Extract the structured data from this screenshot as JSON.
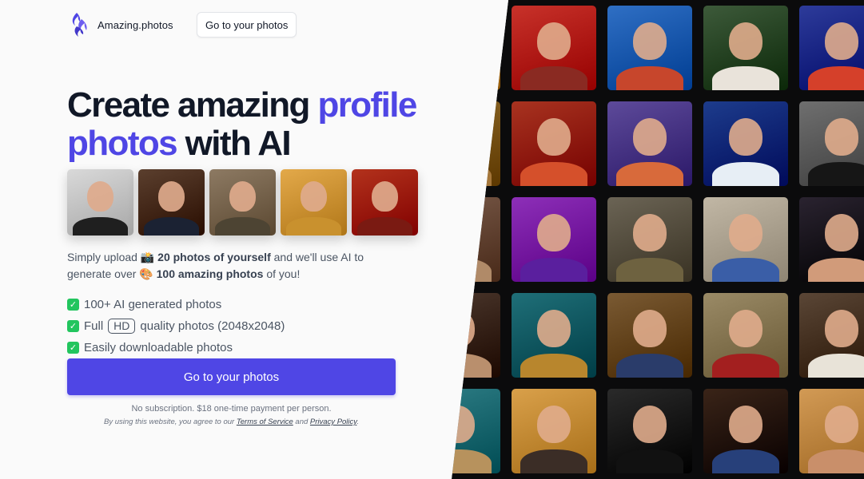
{
  "header": {
    "logo_text": "Amazing.photos",
    "nav_button": "Go to your photos"
  },
  "hero": {
    "title_part1": "Create amazing ",
    "title_accent1": "profile",
    "title_accent2": "photos",
    "title_part2": " with AI"
  },
  "description": {
    "t1": "Simply upload ",
    "emoji1": "📸",
    "b1": " 20 photos of yourself",
    "t2": " and we'll use AI to generate over ",
    "emoji2": "🎨",
    "b2": " 100 amazing photos",
    "t3": " of you!"
  },
  "features": {
    "f1": "100+ AI generated photos",
    "f2_pre": "Full",
    "f2_badge": "HD",
    "f2_post": "quality photos (2048x2048)",
    "f3": "Easily downloadable photos",
    "check_glyph": "✓"
  },
  "cta": {
    "label": "Go to your photos",
    "note": "No subscription. $18 one-time payment per person.",
    "legal_pre": "By using this website, you agree to our ",
    "terms": "Terms of Service",
    "legal_mid": " and ",
    "privacy": "Privacy Policy",
    "legal_post": "."
  },
  "colors": {
    "accent": "#4f46e5",
    "check": "#22c55e"
  },
  "thumbnails": [
    {
      "name": "thumb-tuxedo",
      "bg": "#d9d9d9",
      "outfit": "#1f1f1f"
    },
    {
      "name": "thumb-officer",
      "bg": "#5b3f2e",
      "outfit": "#1b2233"
    },
    {
      "name": "thumb-soldier",
      "bg": "#8d7a63",
      "outfit": "#4d4433"
    },
    {
      "name": "thumb-golden-armor",
      "bg": "#e3a94a",
      "outfit": "#c9912e"
    },
    {
      "name": "thumb-superhero",
      "bg": "#b3321c",
      "outfit": "#7a1a12"
    }
  ],
  "wall_tiles": [
    {
      "name": "wall-tile-red-hoodie",
      "bg": "#c8322a",
      "outfit": "#8a2a22"
    },
    {
      "name": "wall-tile-blue-sky",
      "bg": "#2f6fc4",
      "outfit": "#c7462c"
    },
    {
      "name": "wall-tile-forest",
      "bg": "#3d5a3a",
      "outfit": "#e9e3da"
    },
    {
      "name": "wall-tile-fantasy-armor",
      "bg": "#2d3b9a",
      "outfit": "#d5402a"
    },
    {
      "name": "wall-tile-orange-hoodie",
      "bg": "#a83320",
      "outfit": "#d5502b"
    },
    {
      "name": "wall-tile-mage",
      "bg": "#5d4a9a",
      "outfit": "#d86a3b"
    },
    {
      "name": "wall-tile-facepaint",
      "bg": "#1d3c8c",
      "outfit": "#e7eef5"
    },
    {
      "name": "wall-tile-tuxedo",
      "bg": "#6f6f6f",
      "outfit": "#161616"
    },
    {
      "name": "wall-tile-cyber-neon",
      "bg": "#8d2fb8",
      "outfit": "#5a1f9e"
    },
    {
      "name": "wall-tile-soldier-cap",
      "bg": "#6b6455",
      "outfit": "#6e6240"
    },
    {
      "name": "wall-tile-steampunk",
      "bg": "#c1b7a5",
      "outfit": "#3a5ea7"
    },
    {
      "name": "wall-tile-shirtless",
      "bg": "#2a2330",
      "outfit": "#d19b7a"
    },
    {
      "name": "wall-tile-mosaic",
      "bg": "#1f6f78",
      "outfit": "#b8862d"
    },
    {
      "name": "wall-tile-victorian",
      "bg": "#7a5a33",
      "outfit": "#2a3c6a"
    },
    {
      "name": "wall-tile-roman",
      "bg": "#9a8a66",
      "outfit": "#a31f1f"
    },
    {
      "name": "wall-tile-gentleman",
      "bg": "#5a4636",
      "outfit": "#e8e3d8"
    },
    {
      "name": "wall-tile-scifi-warrior",
      "bg": "#d9a04a",
      "outfit": "#3b2d26"
    },
    {
      "name": "wall-tile-suit",
      "bg": "#2a2a2a",
      "outfit": "#111111"
    },
    {
      "name": "wall-tile-blue-velvet",
      "bg": "#3a2418",
      "outfit": "#27407a"
    },
    {
      "name": "wall-tile-beach",
      "bg": "#d29a55",
      "outfit": "#c98f6a"
    },
    {
      "name": "wall-tile-edge-1",
      "bg": "#c58c3a",
      "outfit": "#c48a4a"
    },
    {
      "name": "wall-tile-edge-2",
      "bg": "#8f6a2a",
      "outfit": "#a5773b"
    },
    {
      "name": "wall-tile-edge-3",
      "bg": "#7a5b4a",
      "outfit": "#b08a68"
    },
    {
      "name": "wall-tile-edge-4",
      "bg": "#4e3a2f",
      "outfit": "#b98f6d"
    },
    {
      "name": "wall-tile-edge-5",
      "bg": "#2f7e86",
      "outfit": "#b7925d"
    }
  ]
}
